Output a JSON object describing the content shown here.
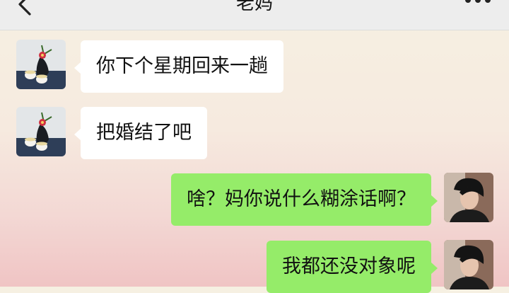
{
  "header": {
    "title": "老妈",
    "back_icon": "chevron-left-icon",
    "more_icon": "ellipsis-icon",
    "bg_color": "#ededed"
  },
  "messages": [
    {
      "sender": "mom",
      "text": "你下个星期回来一趟"
    },
    {
      "sender": "mom",
      "text": "把婚结了吧"
    },
    {
      "sender": "me",
      "text": "啥？妈你说什么糊涂话啊？"
    },
    {
      "sender": "me",
      "text": "我都还没对象呢"
    }
  ],
  "colors": {
    "incoming_bubble": "#ffffff",
    "outgoing_bubble": "#95ec69"
  }
}
